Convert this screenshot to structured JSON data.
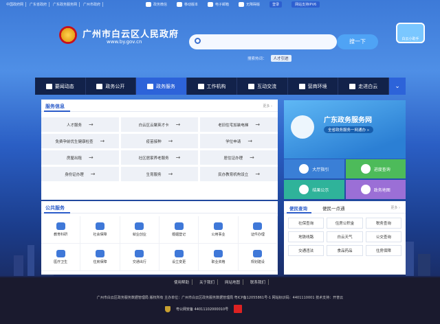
{
  "topbar": {
    "links": [
      "中国政府网",
      "广东省政府",
      "广东政务服务网",
      "广州市政府"
    ],
    "right_items": [
      {
        "label": "政务微信",
        "icon": "wechat-icon"
      },
      {
        "label": "移动版本",
        "icon": "mobile-icon"
      },
      {
        "label": "电子邮箱",
        "icon": "mail-icon"
      },
      {
        "label": "无障碍版",
        "icon": "accessibility-icon"
      }
    ],
    "login": "登录",
    "ipv6": "网站支持IPV6"
  },
  "header": {
    "title": "广州市白云区人民政府",
    "domain": "www.by.gov.cn",
    "search_placeholder": "",
    "search_button": "搜一下",
    "hot_label": "搜索热词：",
    "hot_tags": [
      "人才引进"
    ],
    "mascot": "白云小助手"
  },
  "nav": [
    {
      "label": "要闻动态",
      "icon": "news-icon"
    },
    {
      "label": "政务公开",
      "icon": "gear-icon"
    },
    {
      "label": "政务服务",
      "icon": "heart-hand-icon"
    },
    {
      "label": "工作机构",
      "icon": "building-icon"
    },
    {
      "label": "互动交流",
      "icon": "chat-icon"
    },
    {
      "label": "营商环境",
      "icon": "chart-icon"
    },
    {
      "label": "走进白云",
      "icon": "grid-icon"
    }
  ],
  "services": {
    "title": "服务信息",
    "more": "更多 ›",
    "items": [
      "人才服务",
      "白云区云聚英才卡",
      "老旧住宅加装电梯",
      "免费孕前优生健康检查",
      "疫苗接种",
      "学位申请",
      "房屋出租",
      "社区居家养老服务",
      "居住证办理",
      "身份证办理",
      "生育服务",
      "民办教育机构设立"
    ]
  },
  "public_services": {
    "title": "公共服务",
    "items": [
      {
        "label": "教育科研",
        "icon": "graduation-cap-icon"
      },
      {
        "label": "社会保障",
        "icon": "social-security-icon"
      },
      {
        "label": "就业创业",
        "icon": "briefcase-icon"
      },
      {
        "label": "婚姻登记",
        "icon": "rings-icon"
      },
      {
        "label": "公用事业",
        "icon": "heart-person-icon"
      },
      {
        "label": "证件办理",
        "icon": "id-card-icon"
      },
      {
        "label": "医疗卫生",
        "icon": "medical-icon"
      },
      {
        "label": "住房保障",
        "icon": "house-icon"
      },
      {
        "label": "交通出行",
        "icon": "bus-icon"
      },
      {
        "label": "设立变更",
        "icon": "document-icon"
      },
      {
        "label": "职业资格",
        "icon": "badge-icon"
      },
      {
        "label": "规划建设",
        "icon": "planning-icon"
      }
    ]
  },
  "banner": {
    "title": "广东政务服务网",
    "subtitle": "全省政务服务一网通办 »"
  },
  "tiles": [
    {
      "label": "大厅指引",
      "color": "#3a7fd6",
      "icon": "signpost-icon"
    },
    {
      "label": "进度查询",
      "color": "#4dbb5a",
      "icon": "search-icon"
    },
    {
      "label": "结果公示",
      "color": "#2fb39a",
      "icon": "megaphone-icon"
    },
    {
      "label": "政务地图",
      "color": "#9b6fd6",
      "icon": "compass-icon"
    }
  ],
  "convenient": {
    "tab_active": "便民查询",
    "tab_other": "便民一点通",
    "more": "更多 ›",
    "items": [
      "社保查询",
      "住房公积金",
      "税务查询",
      "地铁线路",
      "白云天气",
      "公交查询",
      "交通违法",
      "食品药品",
      "住房保障"
    ]
  },
  "footer": {
    "links": [
      "使用帮助",
      "关于我们",
      "网站地图",
      "联系我们"
    ],
    "info": "广州市白云区政务服务数据管理局 版权所有 主办单位：广州市白云区政务服务数据管理局 粤ICP备12055861号-1 网站标识码：4401110001 技术支持：开普云",
    "beian": "粤公网安备 44011102000010号"
  },
  "colors": {
    "nav_active": "#2d63d9",
    "nav_bg": "#12224a",
    "accent": "#2a5bc9"
  }
}
